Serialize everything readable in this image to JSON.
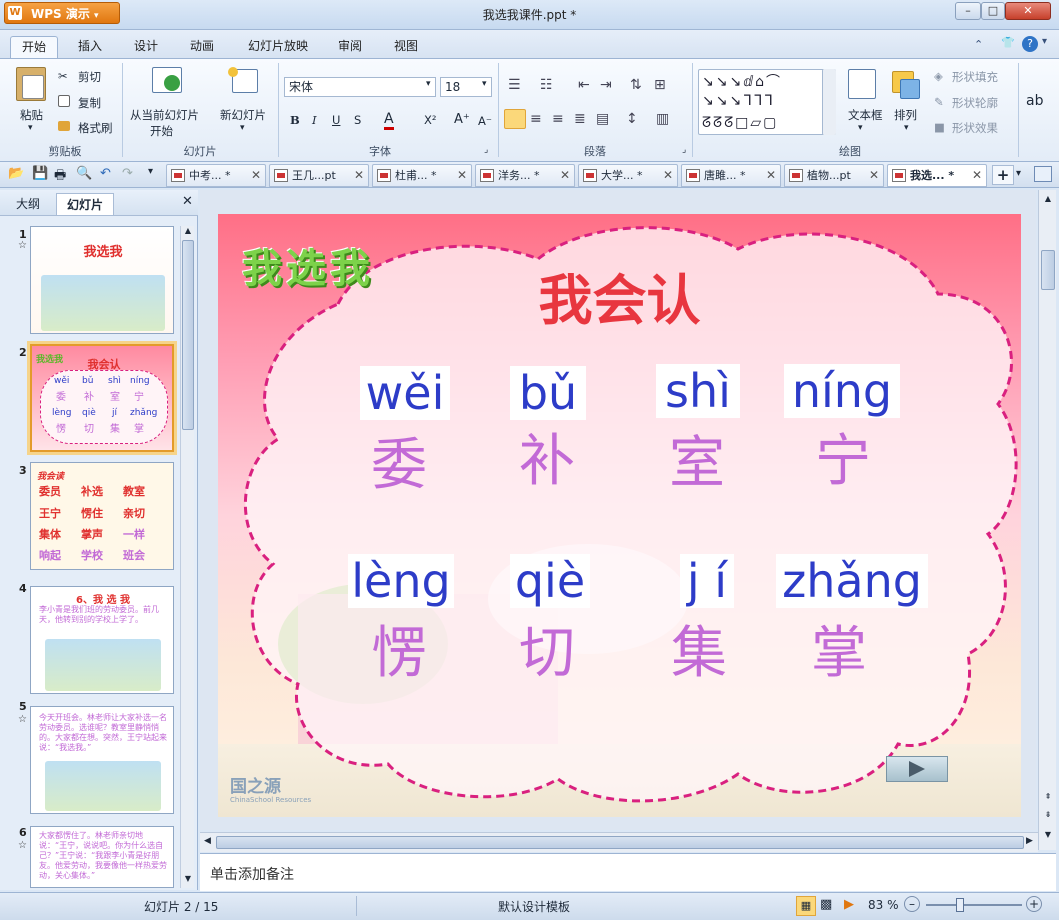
{
  "window": {
    "app_name": "WPS 演示",
    "app_logo": "W",
    "doc_title": "我选我课件.ppt *"
  },
  "ribbon_tabs": [
    "开始",
    "插入",
    "设计",
    "动画",
    "幻灯片放映",
    "审阅",
    "视图"
  ],
  "ribbon": {
    "clipboard": {
      "paste": "粘贴",
      "cut": "剪切",
      "copy": "复制",
      "format_painter": "格式刷",
      "group": "剪贴板"
    },
    "slides": {
      "from_current": "从当前幻灯片",
      "start": "开始",
      "new_slide": "新幻灯片",
      "group": "幻灯片"
    },
    "font": {
      "name": "宋体",
      "size": "18",
      "group": "字体",
      "bold": "B",
      "italic": "I",
      "underline": "U",
      "strike": "S",
      "color": "A",
      "superscript": "X²",
      "grow": "A⁺",
      "shrink": "A⁻"
    },
    "paragraph": {
      "group": "段落"
    },
    "drawing": {
      "textbox": "文本框",
      "arrange": "排列",
      "shape_fill": "形状填充",
      "shape_outline": "形状轮廓",
      "shape_effects": "形状效果",
      "group": "绘图"
    }
  },
  "doc_tabs": [
    {
      "label": "中考... *"
    },
    {
      "label": "王几...pt"
    },
    {
      "label": "杜甫... *"
    },
    {
      "label": "洋务... *"
    },
    {
      "label": "大学... *"
    },
    {
      "label": "唐雎... *"
    },
    {
      "label": "植物...pt"
    },
    {
      "label": "我选... *"
    }
  ],
  "left_pane": {
    "tabs": [
      "大纲",
      "幻灯片"
    ],
    "thumbs": [
      {
        "num": "1",
        "title": "我选我"
      },
      {
        "num": "2",
        "title": "我会认",
        "pinyin": [
          "wěi",
          "bǔ",
          "shì",
          "níng",
          "lèng",
          "qiè",
          "jí",
          "zhǎng"
        ],
        "hanzi": [
          "委",
          "补",
          "室",
          "宁",
          "愣",
          "切",
          "集",
          "掌"
        ]
      },
      {
        "num": "3",
        "title": "我会读",
        "words": [
          "委员",
          "补选",
          "教室",
          "王宁",
          "愣住",
          "亲切",
          "集体",
          "掌声",
          "一样",
          "响起",
          "学校",
          "班会"
        ]
      },
      {
        "num": "4",
        "title": "6、我 选 我",
        "text": "李小青是我们班的劳动委员。前几天，他转到别的学校上学了。"
      },
      {
        "num": "5",
        "text": "今天开班会。林老师让大家补选一名劳动委员。选谁呢？教室里静悄悄的。大家都在想。突然，王宁站起来说：“我选我。”"
      },
      {
        "num": "6",
        "text": "大家都愣住了。林老师亲切地说：“王宁，说说吧。你为什么选自己？”王宁说：“我跟李小青是好朋友。他爱劳动，我要像他一样热爱劳动，关心集体。”"
      }
    ]
  },
  "slide": {
    "badge": "我选我",
    "title": "我会认",
    "row1_pinyin": [
      "wěi",
      "bǔ",
      "shì",
      "níng"
    ],
    "row1_hanzi": [
      "委",
      "补",
      "室",
      "宁"
    ],
    "row2_pinyin": [
      "lèng",
      "qiè",
      "j í",
      "zhǎng"
    ],
    "row2_hanzi": [
      "愣",
      "切",
      "集",
      "掌"
    ],
    "watermark": "国之源",
    "watermark_sub": "ChinaSchool Resources"
  },
  "notes_placeholder": "单击添加备注",
  "status": {
    "slide_counter": "幻灯片 2 / 15",
    "template": "默认设计模板",
    "zoom": "83 %"
  },
  "colors": {
    "accent_orange": "#e07710",
    "title_red": "#e8363f",
    "pinyin_blue": "#2d3cc8",
    "hanzi_purple": "#c26ad6",
    "dash_magenta": "#d9207f"
  }
}
